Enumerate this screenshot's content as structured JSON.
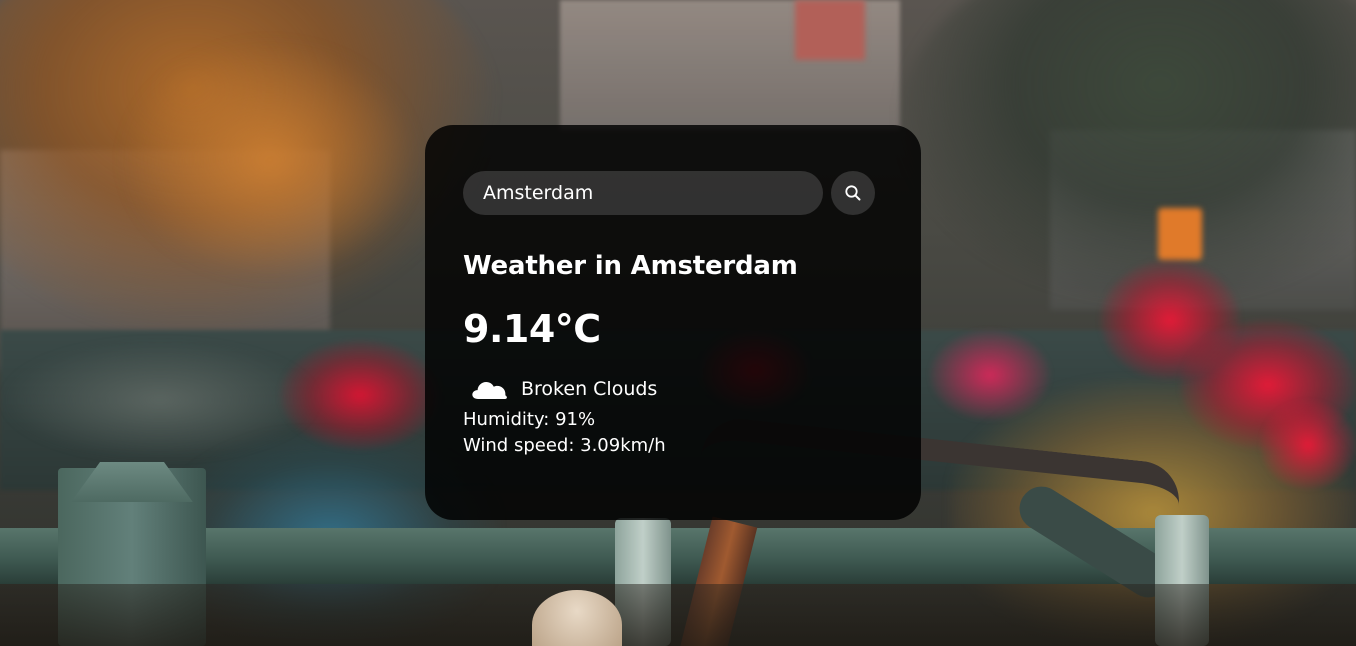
{
  "search": {
    "value": "Amsterdam",
    "placeholder": "Search"
  },
  "weather": {
    "title": "Weather in Amsterdam",
    "temperature": "9.14°C",
    "icon": "cloud-icon",
    "description": "Broken Clouds",
    "humidity": "Humidity: 91%",
    "wind": "Wind speed: 3.09km/h"
  },
  "colors": {
    "card_background": "#000000",
    "text": "#ffffff",
    "input_background": "#7c7c7c"
  },
  "background": {
    "description_icon": "photo-background"
  }
}
